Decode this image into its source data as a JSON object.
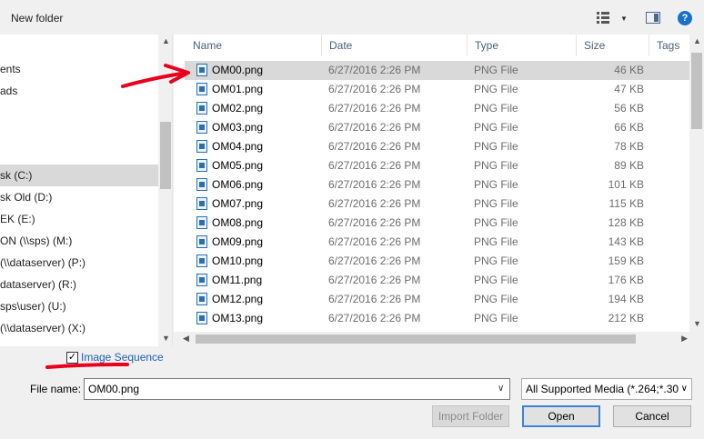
{
  "toolbar": {
    "new_folder": "New folder",
    "view_icon": "view-options-icon",
    "pane_icon": "preview-pane-icon",
    "help_label": "?"
  },
  "nav": {
    "items": [
      {
        "label": "ents",
        "selected": false
      },
      {
        "label": "ads",
        "selected": false
      },
      {
        "label": "",
        "selected": false
      },
      {
        "label": "",
        "selected": false
      },
      {
        "label": "sk (C:)",
        "selected": true
      },
      {
        "label": "sk Old (D:)",
        "selected": false
      },
      {
        "label": "EK (E:)",
        "selected": false
      },
      {
        "label": "ON (\\\\sps) (M:)",
        "selected": false
      },
      {
        "label": " (\\\\dataserver) (P:)",
        "selected": false
      },
      {
        "label": "dataserver) (R:)",
        "selected": false
      },
      {
        "label": "sps\\user) (U:)",
        "selected": false
      },
      {
        "label": " (\\\\dataserver) (X:)",
        "selected": false
      }
    ]
  },
  "columns": {
    "name": "Name",
    "date": "Date",
    "type": "Type",
    "size": "Size",
    "tags": "Tags"
  },
  "files": [
    {
      "name": "OM00.png",
      "date": "6/27/2016 2:26 PM",
      "type": "PNG File",
      "size": "46 KB",
      "selected": true
    },
    {
      "name": "OM01.png",
      "date": "6/27/2016 2:26 PM",
      "type": "PNG File",
      "size": "47 KB"
    },
    {
      "name": "OM02.png",
      "date": "6/27/2016 2:26 PM",
      "type": "PNG File",
      "size": "56 KB"
    },
    {
      "name": "OM03.png",
      "date": "6/27/2016 2:26 PM",
      "type": "PNG File",
      "size": "66 KB"
    },
    {
      "name": "OM04.png",
      "date": "6/27/2016 2:26 PM",
      "type": "PNG File",
      "size": "78 KB"
    },
    {
      "name": "OM05.png",
      "date": "6/27/2016 2:26 PM",
      "type": "PNG File",
      "size": "89 KB"
    },
    {
      "name": "OM06.png",
      "date": "6/27/2016 2:26 PM",
      "type": "PNG File",
      "size": "101 KB"
    },
    {
      "name": "OM07.png",
      "date": "6/27/2016 2:26 PM",
      "type": "PNG File",
      "size": "115 KB"
    },
    {
      "name": "OM08.png",
      "date": "6/27/2016 2:26 PM",
      "type": "PNG File",
      "size": "128 KB"
    },
    {
      "name": "OM09.png",
      "date": "6/27/2016 2:26 PM",
      "type": "PNG File",
      "size": "143 KB"
    },
    {
      "name": "OM10.png",
      "date": "6/27/2016 2:26 PM",
      "type": "PNG File",
      "size": "159 KB"
    },
    {
      "name": "OM11.png",
      "date": "6/27/2016 2:26 PM",
      "type": "PNG File",
      "size": "176 KB"
    },
    {
      "name": "OM12.png",
      "date": "6/27/2016 2:26 PM",
      "type": "PNG File",
      "size": "194 KB"
    },
    {
      "name": "OM13.png",
      "date": "6/27/2016 2:26 PM",
      "type": "PNG File",
      "size": "212 KB"
    }
  ],
  "image_sequence": {
    "label": "Image Sequence",
    "checked": true,
    "check_glyph": "✓"
  },
  "file_name": {
    "label": "File name:",
    "value": "OM00.png"
  },
  "filter": {
    "selected": "All Supported Media (*.264;*.30"
  },
  "buttons": {
    "import_folder": "Import Folder",
    "open": "Open",
    "cancel": "Cancel"
  },
  "colors": {
    "annotation": "#e8001c",
    "link": "#1a5fb4",
    "selection": "#d9d9d9"
  }
}
